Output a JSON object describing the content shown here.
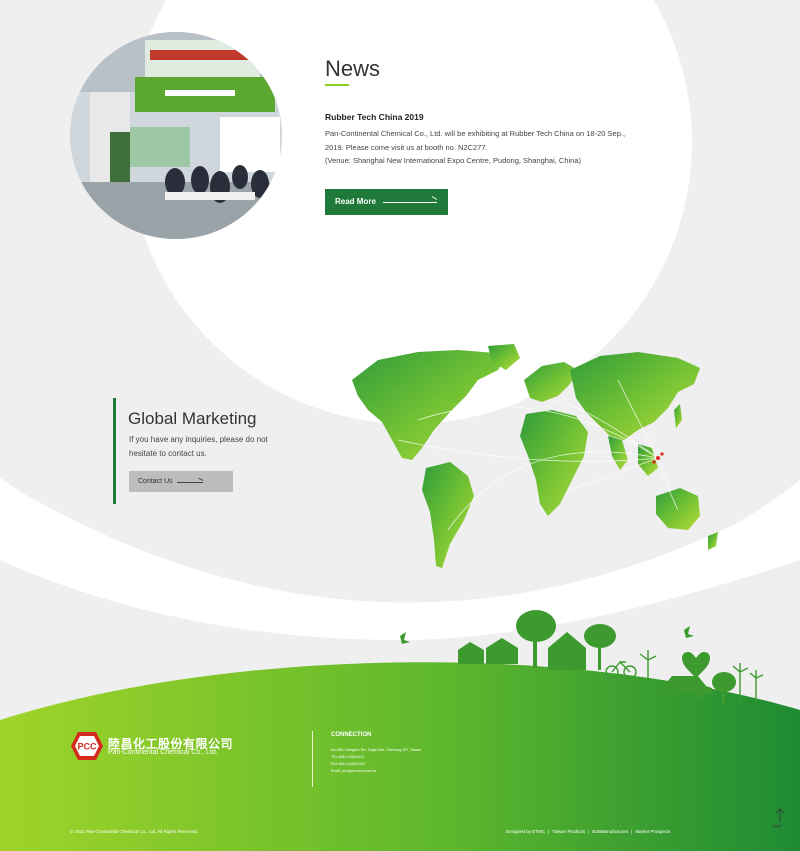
{
  "news": {
    "title": "News",
    "headline": "Rubber Tech China 2019",
    "body_line1": "Pan-Continental Chemical Co., Ltd. will be exhibiting at Rubber Tech China on 18-20 Sep., 2019. Please come visit us at booth no. N2C277.",
    "body_line2": "(Venue: Shanghai New International Expo Centre, Pudong, Shanghai, China)",
    "read_more": "Read More"
  },
  "global_marketing": {
    "title": "Global Marketing",
    "body": "If you have any inquiries, please do not hesitate to contact us.",
    "contact_button": "Contact Us"
  },
  "footer": {
    "logo_mark": "PCC",
    "company_cn": "陸昌化工股份有限公司",
    "company_en": "Pan-Continental Chemical Co., Ltd.",
    "connection_title": "CONNECTION",
    "address": "No.389, Chingsen Rd., Dajia Dist., Taichung 437, Taiwan.",
    "tel": "TEL:886-4-26811191",
    "fax": "FAX:886-4-26811323",
    "email": "Email: pcc@pcchem.com.tw",
    "copyright": "© 2021 Pan-Continental Chemical Co., Ltd. All Rights Reserved.",
    "links": [
      "Designed by ETMC",
      "Taiwan Products",
      "B2BManufactures",
      "Market Prospects"
    ],
    "top_label": "TOP"
  },
  "colors": {
    "brand_green": "#1f7a3a",
    "accent_green": "#8ccb23",
    "logo_red": "#d62a1e",
    "background": "#efefef"
  }
}
